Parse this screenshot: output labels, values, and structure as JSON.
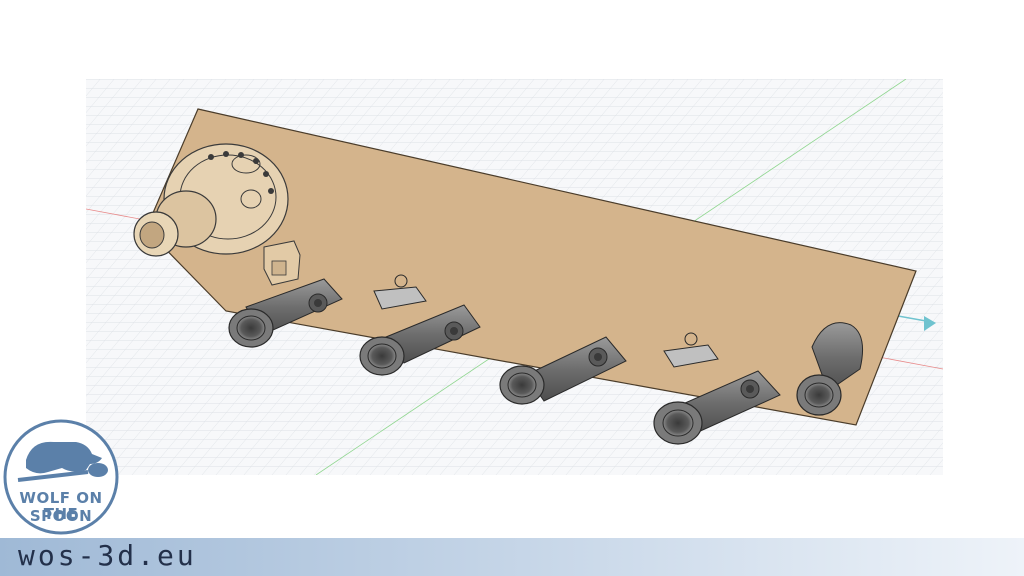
{
  "viewport": {
    "name": "3D modeling canvas",
    "background": "#f7f8fa",
    "grid_color": "#d6dbe2",
    "plate_color": "#d4b48c",
    "part_color": "#7a7a7a",
    "axis_x_color": "#e06666",
    "axis_y_color": "#7bcf7b",
    "axis_z_color": "#6fc3cf"
  },
  "logo": {
    "line1": "WOLF ON THE",
    "line2": "SPOON",
    "color": "#5b80a9"
  },
  "footer": {
    "url": "wos-3d.eu"
  }
}
